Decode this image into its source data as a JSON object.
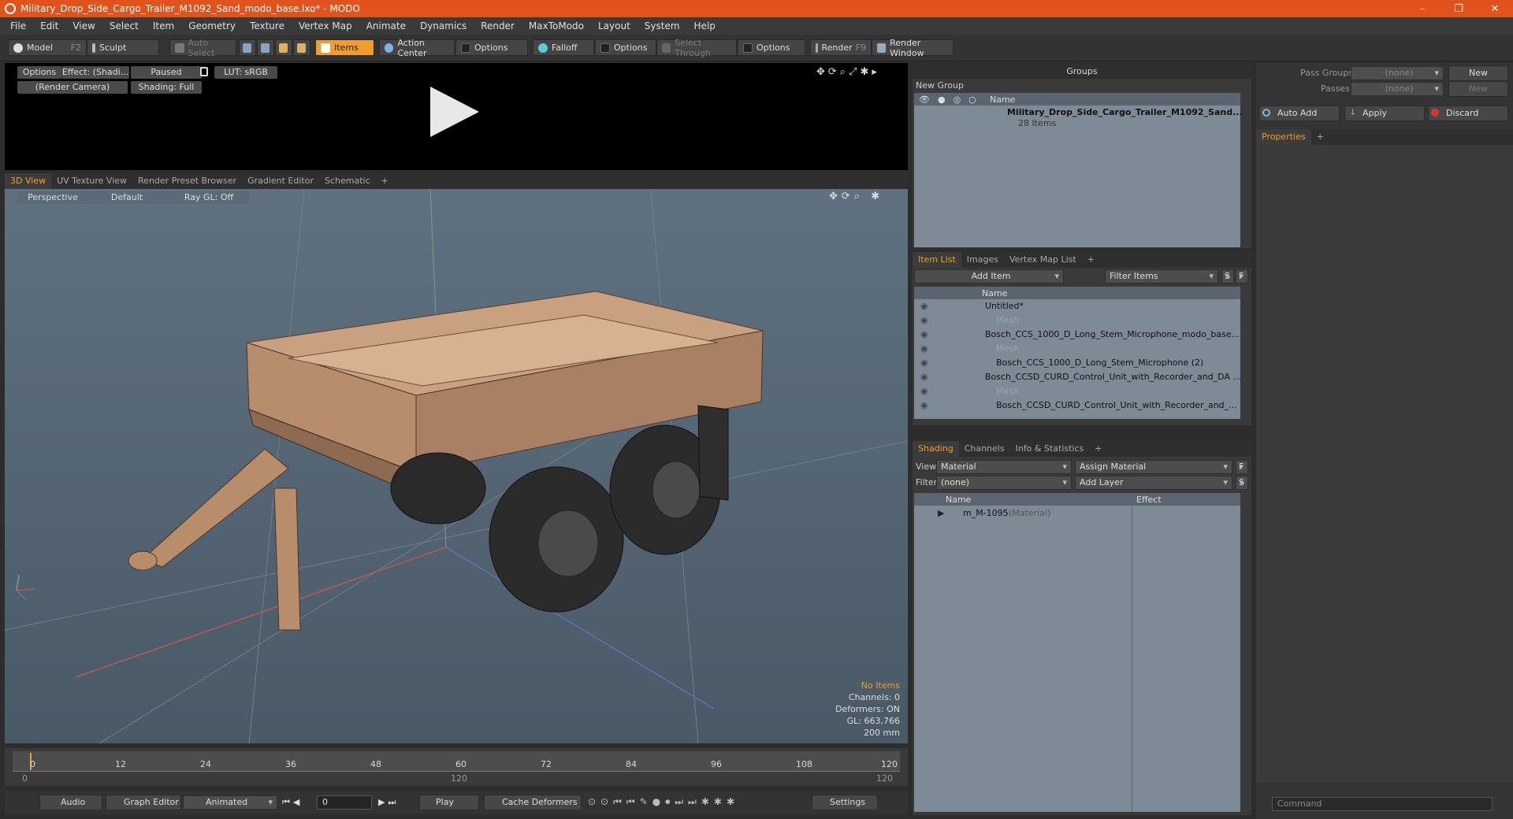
{
  "window": {
    "title": "Military_Drop_Side_Cargo_Trailer_M1092_Sand_modo_base.lxo* - MODO",
    "min": "–",
    "max": "❐",
    "close": "✕"
  },
  "menu": [
    "File",
    "Edit",
    "View",
    "Select",
    "Item",
    "Geometry",
    "Texture",
    "Vertex Map",
    "Animate",
    "Dynamics",
    "Render",
    "MaxToModo",
    "Layout",
    "System",
    "Help"
  ],
  "toolbar": {
    "model": "Model",
    "model_key": "F2",
    "sculpt": "Sculpt",
    "auto_select": "Auto Select",
    "items": "Items",
    "action_center": "Action Center",
    "options1": "Options",
    "falloff": "Falloff",
    "options2": "Options",
    "select_through": "Select Through",
    "options3": "Options",
    "render": "Render",
    "render_key": "F9",
    "render_window": "Render Window"
  },
  "preview": {
    "options": "Options",
    "effect": "Effect: (Shadi...",
    "paused": "Paused",
    "lut": "LUT: sRGB",
    "camera": "(Render Camera)",
    "shading": "Shading: Full"
  },
  "viewport_tabs": [
    "3D View",
    "UV Texture View",
    "Render Preset Browser",
    "Gradient Editor",
    "Schematic",
    "+"
  ],
  "viewport": {
    "perspective": "Perspective",
    "default": "Default",
    "raygl": "Ray GL: Off"
  },
  "overlay": {
    "no_items": "No Items",
    "channels": "Channels: 0",
    "deformers": "Deformers: ON",
    "gl": "GL: 663,766",
    "scale": "200 mm"
  },
  "timeline": {
    "ticks": [
      "0",
      "12",
      "24",
      "36",
      "48",
      "60",
      "72",
      "84",
      "96",
      "108",
      "120"
    ],
    "sub0": "0",
    "sub120a": "120",
    "sub120b": "120"
  },
  "bottombar": {
    "audio": "Audio",
    "graph": "Graph Editor",
    "animated": "Animated",
    "frame": "0",
    "play": "Play",
    "cache": "Cache Deformers",
    "settings": "Settings"
  },
  "groups": {
    "title": "Groups",
    "new_group": "New Group",
    "col_name": "Name",
    "item_name": "Military_Drop_Side_Cargo_Trailer_M1092_Sand...",
    "item_count": "28 Items"
  },
  "itemlist": {
    "tabs": [
      "Item List",
      "Images",
      "Vertex Map List",
      "+"
    ],
    "add_item": "Add Item",
    "filter": "Filter Items",
    "s": "S",
    "f": "F",
    "col_name": "Name",
    "rows": [
      {
        "label": "Untitled*",
        "indent": 0,
        "dim": false
      },
      {
        "label": "Mesh",
        "indent": 1,
        "dim": true
      },
      {
        "label": "Bosch_CCS_1000_D_Long_Stem_Microphone_modo_base....",
        "indent": 0,
        "dim": false
      },
      {
        "label": "Mesh",
        "indent": 1,
        "dim": true
      },
      {
        "label": "Bosch_CCS_1000_D_Long_Stem_Microphone (2)",
        "indent": 1,
        "dim": false
      },
      {
        "label": "Bosch_CCSD_CURD_Control_Unit_with_Recorder_and_DA ...",
        "indent": 0,
        "dim": false
      },
      {
        "label": "Mesh",
        "indent": 1,
        "dim": true
      },
      {
        "label": "Bosch_CCSD_CURD_Control_Unit_with_Recorder_and_...",
        "indent": 1,
        "dim": false
      }
    ]
  },
  "shading": {
    "tabs": [
      "Shading",
      "Channels",
      "Info & Statistics",
      "+"
    ],
    "view_label": "View",
    "view_value": "Material",
    "assign": "Assign Material",
    "f": "F",
    "filter_label": "Filter",
    "filter_value": "(none)",
    "add_layer": "Add Layer",
    "s": "S",
    "col_name": "Name",
    "col_effect": "Effect",
    "material": "m_M-1095",
    "material_type": "(Material)"
  },
  "right": {
    "pass_groups": "Pass Groups",
    "passes": "Passes",
    "none1": "(none)",
    "none2": "(none)",
    "new1": "New",
    "new2": "New",
    "auto_add": "Auto Add",
    "apply": "Apply",
    "discard": "Discard",
    "properties": "Properties",
    "plus": "+",
    "command": "Command"
  }
}
